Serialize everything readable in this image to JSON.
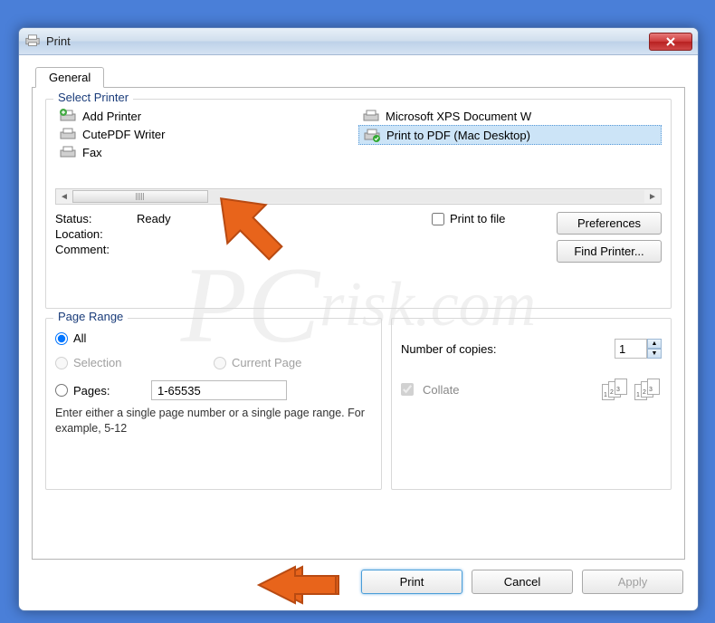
{
  "window": {
    "title": "Print"
  },
  "tab": {
    "general": "General"
  },
  "select_printer": {
    "title": "Select Printer",
    "items": [
      {
        "label": "Add Printer"
      },
      {
        "label": "CutePDF Writer"
      },
      {
        "label": "Fax"
      },
      {
        "label": "Microsoft XPS Document W"
      },
      {
        "label": "Print to PDF (Mac Desktop)"
      }
    ],
    "status_label": "Status:",
    "status_value": "Ready",
    "location_label": "Location:",
    "comment_label": "Comment:",
    "print_to_file": "Print to file",
    "preferences": "Preferences",
    "find_printer": "Find Printer..."
  },
  "page_range": {
    "title": "Page Range",
    "all": "All",
    "selection": "Selection",
    "current_page": "Current Page",
    "pages": "Pages:",
    "pages_value": "1-65535",
    "help": "Enter either a single page number or a single page range.  For example, 5-12"
  },
  "copies": {
    "label": "Number of copies:",
    "value": "1",
    "collate": "Collate"
  },
  "buttons": {
    "print": "Print",
    "cancel": "Cancel",
    "apply": "Apply"
  }
}
